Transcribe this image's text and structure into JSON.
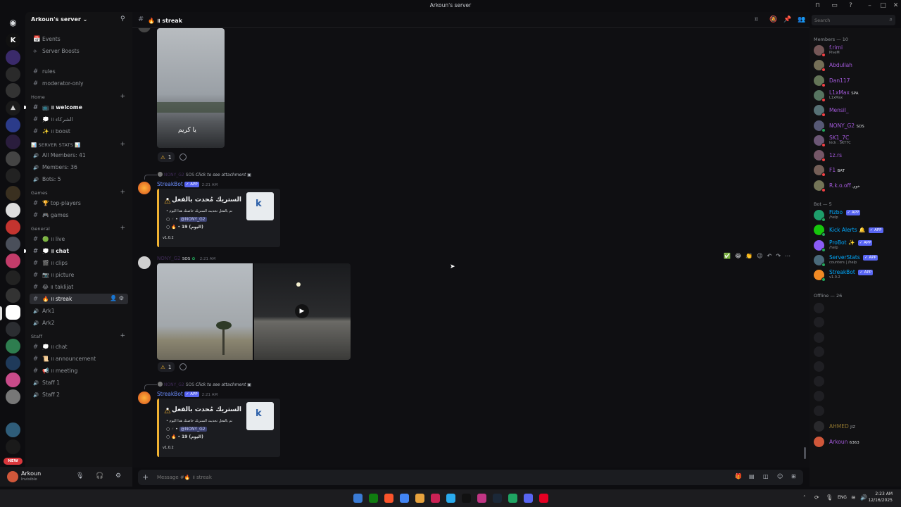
{
  "window": {
    "title": "Arkoun's server"
  },
  "server": {
    "name": "Arkoun's server"
  },
  "search": {
    "placeholder": "Search"
  },
  "sidebar": {
    "top_items": [
      {
        "label": "Events",
        "icon": "calendar-icon"
      },
      {
        "label": "Server Boosts",
        "icon": "boost-icon"
      }
    ],
    "top_channels": [
      {
        "label": "rules"
      },
      {
        "label": "moderator-only"
      }
    ],
    "categories": [
      {
        "name": "Home",
        "channels": [
          {
            "label": "📺 ॥ welcome",
            "bold": true,
            "active": false,
            "unread": true
          },
          {
            "label": "💭 ॥ الشركاء",
            "bold": false,
            "active": false
          },
          {
            "label": "✨ ॥ boost",
            "bold": false,
            "active": false
          }
        ]
      },
      {
        "name": "📊 SERVER STATS 📊",
        "channels": [
          {
            "label": "All Members: 41",
            "bold": false,
            "voice": true
          },
          {
            "label": "Members: 36",
            "bold": false,
            "voice": true
          },
          {
            "label": "Bots: 5",
            "bold": false,
            "voice": true
          }
        ]
      },
      {
        "name": "Games",
        "channels": [
          {
            "label": "🏆 top-players",
            "bold": false
          },
          {
            "label": "🎮 games",
            "bold": false
          }
        ]
      },
      {
        "name": "General",
        "channels": [
          {
            "label": "🟢 ॥ live",
            "bold": false
          },
          {
            "label": "💭 ॥ chat",
            "bold": true,
            "unread": true
          },
          {
            "label": "🎬 ॥ clips",
            "bold": false
          },
          {
            "label": "📷 ॥ picture",
            "bold": false
          },
          {
            "label": "😂 ॥ taklijat",
            "bold": false
          },
          {
            "label": "🔥 ॥ streak",
            "bold": false,
            "active": true
          },
          {
            "label": "Ark1",
            "bold": false,
            "voice": true
          },
          {
            "label": "Ark2",
            "bold": false,
            "voice": true
          }
        ]
      },
      {
        "name": "Staff",
        "channels": [
          {
            "label": "💭 ॥ chat",
            "bold": false
          },
          {
            "label": "📜 ॥ announcement",
            "bold": false
          },
          {
            "label": "📢 ॥ meeting",
            "bold": false
          },
          {
            "label": "Staff 1",
            "bold": false,
            "voice": true
          },
          {
            "label": "Staff 2",
            "bold": false,
            "voice": true
          }
        ]
      }
    ]
  },
  "user_panel": {
    "name": "Arkoun",
    "status": "Invisible"
  },
  "rail": {
    "new_badge": "NEW"
  },
  "channel_header": {
    "name": "🔥 ॥ streak"
  },
  "messages": {
    "reaction_count_1": "1",
    "reply1": {
      "user": "NONY_G2",
      "tag": "SOS",
      "text": "Click to see attachment"
    },
    "bot1": {
      "name": "StreakBot",
      "app": "APP",
      "time": "2:21 AM",
      "embed_title": "الستريك مُحدث بالفعل •",
      "line1": "تم بالفعل تحديث الستريك خاصتك هذا اليوم",
      "mention": "@NONY_G2",
      "streak_line": "19 (اليوم)",
      "version": "v1.0.2"
    },
    "user_msg": {
      "name": "NONY_G2",
      "tag": "SOS",
      "time": "2:21 AM"
    },
    "reaction_count_2": "1",
    "reply2": {
      "user": "NONY_G2",
      "tag": "SOS",
      "text": "Click to see attachment"
    },
    "bot2": {
      "name": "StreakBot",
      "app": "APP",
      "time": "2:21 AM",
      "embed_title": "الستريك مُحدث بالفعل •",
      "line1": "تم بالفعل تحديث الستريك خاصتك هذا اليوم",
      "mention": "@NONY_G2",
      "streak_line": "19 (اليوم)",
      "version": "v1.0.2"
    },
    "image_caption": "يا كريم"
  },
  "input": {
    "placeholder": "Message #🔥 ॥ streak"
  },
  "members": {
    "online_header": "Members — 10",
    "online": [
      {
        "name": "f.rimi",
        "sub": "PiveM",
        "color": "#a259d9",
        "status": "#f23f43"
      },
      {
        "name": "Abdullah",
        "sub": "",
        "color": "#a259d9",
        "status": "#f23f43"
      },
      {
        "name": "Dan117",
        "sub": "",
        "color": "#a259d9",
        "status": "#f23f43"
      },
      {
        "name": "L1xMax",
        "sub": "L1xMax",
        "tag": "SPA",
        "color": "#a259d9",
        "status": "#f23f43"
      },
      {
        "name": "Mensil_",
        "sub": "",
        "color": "#a259d9",
        "status": "#f23f43"
      },
      {
        "name": "NONY_G2",
        "sub": "",
        "tag": "SOS",
        "color": "#a259d9",
        "status": "#23a55a"
      },
      {
        "name": "SK1_7C",
        "sub": "kick : SKY7C",
        "color": "#a259d9",
        "status": "#f23f43"
      },
      {
        "name": "1z.rs",
        "sub": "",
        "color": "#a259d9",
        "status": "#f23f43"
      },
      {
        "name": "F1",
        "sub": "",
        "tag": "BAT",
        "color": "#a259d9",
        "status": "#f23f43"
      },
      {
        "name": "R.k.o.off",
        "sub": "",
        "tag": "خوي",
        "color": "#a259d9",
        "status": "#f23f43"
      }
    ],
    "bot_header": "Bot — 5",
    "bots": [
      {
        "name": "Fizbo",
        "sub": "/help",
        "app": "APP",
        "color": "#00a8fc"
      },
      {
        "name": "Kick Alerts 🔔",
        "sub": "",
        "app": "APP",
        "color": "#00a8fc"
      },
      {
        "name": "ProBot ✨",
        "sub": "/help",
        "app": "APP",
        "color": "#00a8fc"
      },
      {
        "name": "ServerStats",
        "sub": "counters | /help",
        "app": "APP",
        "color": "#00a8fc"
      },
      {
        "name": "StreakBot",
        "sub": "v1.0.2",
        "app": "APP",
        "color": "#00a8fc"
      }
    ],
    "offline_header": "Offline — 26",
    "offline_visible": [
      {
        "name": "AHMED",
        "tag": "JIZ",
        "color": "#c6a03a"
      },
      {
        "name": "Arkoun",
        "tag": "6363",
        "color": "#a259d9"
      }
    ]
  },
  "taskbar": {
    "time": "2:23 AM",
    "date": "12/16/2025",
    "lang": "ENG"
  },
  "colors": {
    "accent": "#5865f2",
    "embed_border": "#f0b232",
    "bot_name": "#6c8eff",
    "purple_name": "#a259d9"
  }
}
